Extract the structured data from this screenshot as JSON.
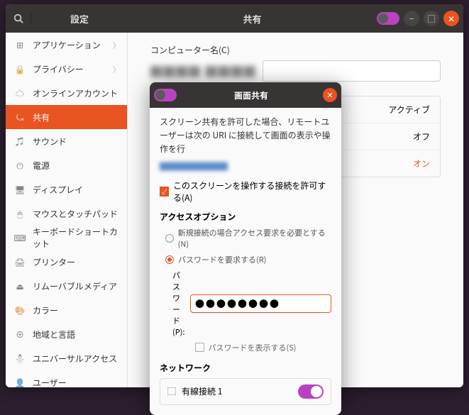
{
  "header": {
    "settings_title": "設定",
    "page_title": "共有"
  },
  "sidebar": {
    "items": [
      {
        "icon": "⊞",
        "label": "アプリケーション",
        "chev": true
      },
      {
        "icon": "🔒",
        "label": "プライバシー",
        "chev": true
      },
      {
        "icon": "☁",
        "label": "オンラインアカウント"
      },
      {
        "icon": "⤿",
        "label": "共有",
        "active": true
      },
      {
        "icon": "♫",
        "label": "サウンド"
      },
      {
        "icon": "⏻",
        "label": "電源"
      },
      {
        "icon": "🖥",
        "label": "ディスプレイ"
      },
      {
        "icon": "🖱",
        "label": "マウスとタッチパッド"
      },
      {
        "icon": "⌨",
        "label": "キーボードショートカット"
      },
      {
        "icon": "🖨",
        "label": "プリンター"
      },
      {
        "icon": "⏏",
        "label": "リムーバブルメディア"
      },
      {
        "icon": "🎨",
        "label": "カラー"
      },
      {
        "icon": "⊕",
        "label": "地域と言語"
      },
      {
        "icon": "⛄",
        "label": "ユニバーサルアクセス"
      },
      {
        "icon": "👤",
        "label": "ユーザー"
      }
    ]
  },
  "main": {
    "computer_name_label": "コンピューター名(C)",
    "blurred_name": "████ ████",
    "rows": [
      {
        "label": "",
        "status": "アクティブ"
      },
      {
        "label": "",
        "status": "オフ"
      },
      {
        "label": "",
        "status": "オン",
        "on": true
      }
    ]
  },
  "modal": {
    "title": "画面共有",
    "desc": "スクリーン共有を許可した場合、リモートユーザーは次の URI に接続して画面の表示や操作を行",
    "blur_link": "████████",
    "allow_label": "このスクリーンを操作する接続を許可する(A)",
    "access_header": "アクセスオプション",
    "radio_new": "新規接続の場合アクセス要求を必要とする(N)",
    "radio_pw": "パスワードを要求する(R)",
    "pw_label": "パスワード(P):",
    "pw_value": "●●●●●●●●",
    "show_pw": "パスワードを表示する(S)",
    "network_header": "ネットワーク",
    "wired_label": "有線接続 1"
  }
}
